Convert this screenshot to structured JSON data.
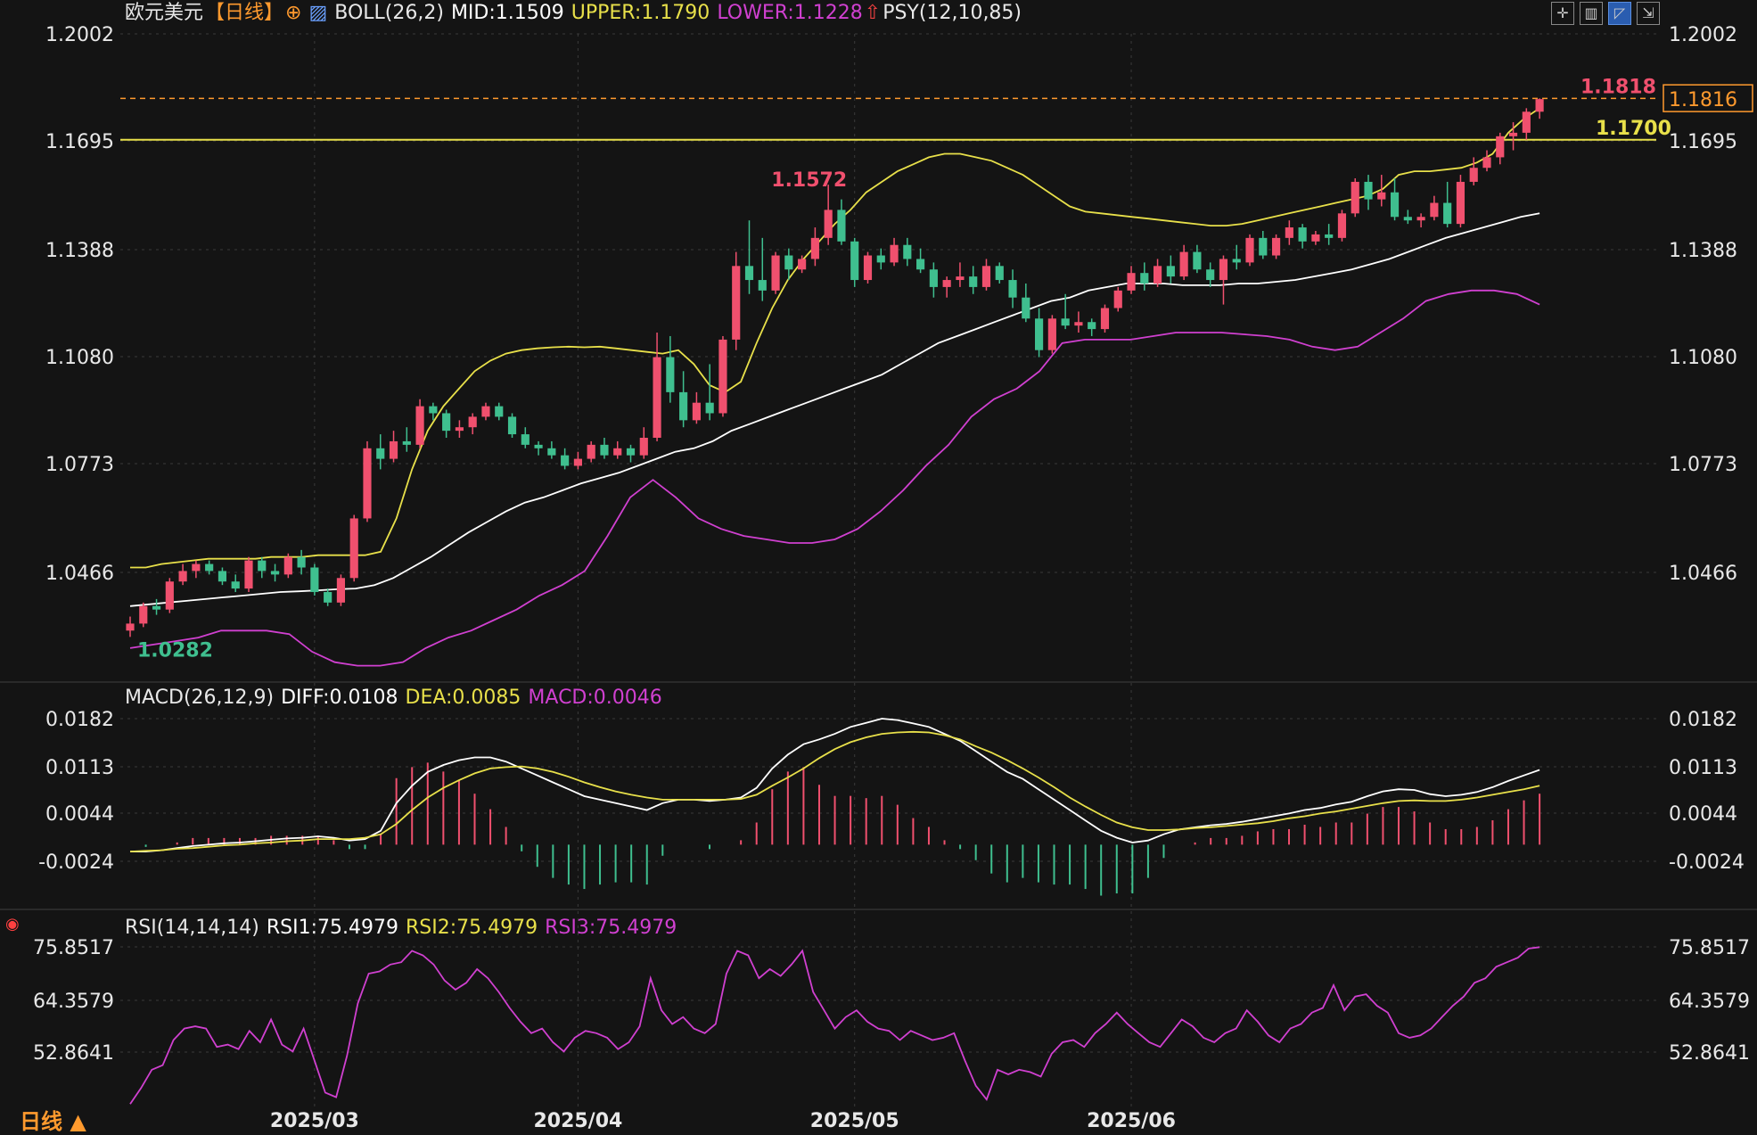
{
  "header": {
    "symbol": "欧元美元",
    "period": "【日线】",
    "boll_label": "BOLL(26,2)",
    "boll_mid": "MID:1.1509",
    "boll_upper": "UPPER:1.1790",
    "boll_lower": "LOWER:1.1228",
    "psy_label": "PSY(12,10,85)"
  },
  "macd_header": {
    "label": "MACD(26,12,9)",
    "diff": "DIFF:0.0108",
    "dea": "DEA:0.0085",
    "macd": "MACD:0.0046"
  },
  "rsi_header": {
    "label": "RSI(14,14,14)",
    "rsi1": "RSI1:75.4979",
    "rsi2": "RSI2:75.4979",
    "rsi3": "RSI3:75.4979"
  },
  "footer": {
    "period_toggle": "日线 ▲"
  },
  "colors": {
    "up": "#f0506e",
    "down": "#3fbf8f",
    "boll_upper": "#e8e04a",
    "boll_mid": "#ffffff",
    "boll_lower": "#d040d0",
    "diff": "#ffffff",
    "dea": "#e8e04a",
    "rsi": "#d040d0",
    "hline": "#e8e04a",
    "last_price": "#ff9a2e"
  },
  "chart_data": [
    {
      "type": "candlestick",
      "name": "price",
      "yticks": [
        "1.2002",
        "1.1695",
        "1.1388",
        "1.1080",
        "1.0773",
        "1.0466"
      ],
      "ylim": [
        1.016,
        1.2002
      ],
      "x_tick_labels": [
        "2025/03",
        "2025/04",
        "2025/05",
        "2025/06"
      ],
      "x_tick_index": [
        14,
        34,
        55,
        76
      ],
      "annotations": {
        "high_label": "1.1572",
        "low_label": "1.0282",
        "max_label": "1.1818",
        "hline_label": "1.1700",
        "last_price_label": "1.1816",
        "hline_value": 1.17,
        "max_value": 1.1818,
        "high_index": 48,
        "low_index": 0
      },
      "candles": [
        [
          1.03,
          1.034,
          1.0282,
          1.032
        ],
        [
          1.032,
          1.038,
          1.031,
          1.037
        ],
        [
          1.037,
          1.039,
          1.0345,
          1.036
        ],
        [
          1.036,
          1.045,
          1.035,
          1.044
        ],
        [
          1.044,
          1.049,
          1.043,
          1.047
        ],
        [
          1.047,
          1.05,
          1.045,
          1.049
        ],
        [
          1.049,
          1.05,
          1.046,
          1.047
        ],
        [
          1.047,
          1.048,
          1.043,
          1.044
        ],
        [
          1.044,
          1.046,
          1.041,
          1.042
        ],
        [
          1.042,
          1.051,
          1.041,
          1.05
        ],
        [
          1.05,
          1.051,
          1.045,
          1.047
        ],
        [
          1.047,
          1.049,
          1.044,
          1.046
        ],
        [
          1.046,
          1.052,
          1.045,
          1.051
        ],
        [
          1.051,
          1.053,
          1.046,
          1.048
        ],
        [
          1.048,
          1.049,
          1.04,
          1.041
        ],
        [
          1.041,
          1.042,
          1.037,
          1.038
        ],
        [
          1.038,
          1.046,
          1.037,
          1.045
        ],
        [
          1.045,
          1.063,
          1.044,
          1.062
        ],
        [
          1.062,
          1.084,
          1.061,
          1.082
        ],
        [
          1.082,
          1.086,
          1.076,
          1.079
        ],
        [
          1.079,
          1.087,
          1.078,
          1.084
        ],
        [
          1.084,
          1.088,
          1.081,
          1.083
        ],
        [
          1.083,
          1.096,
          1.082,
          1.094
        ],
        [
          1.094,
          1.095,
          1.09,
          1.092
        ],
        [
          1.092,
          1.093,
          1.085,
          1.087
        ],
        [
          1.087,
          1.09,
          1.085,
          1.088
        ],
        [
          1.088,
          1.092,
          1.086,
          1.091
        ],
        [
          1.091,
          1.095,
          1.09,
          1.094
        ],
        [
          1.094,
          1.095,
          1.09,
          1.091
        ],
        [
          1.091,
          1.092,
          1.085,
          1.086
        ],
        [
          1.086,
          1.088,
          1.082,
          1.083
        ],
        [
          1.083,
          1.084,
          1.08,
          1.082
        ],
        [
          1.082,
          1.084,
          1.079,
          1.08
        ],
        [
          1.08,
          1.082,
          1.076,
          1.077
        ],
        [
          1.077,
          1.081,
          1.076,
          1.079
        ],
        [
          1.079,
          1.084,
          1.078,
          1.083
        ],
        [
          1.083,
          1.085,
          1.079,
          1.08
        ],
        [
          1.08,
          1.084,
          1.079,
          1.082
        ],
        [
          1.082,
          1.083,
          1.078,
          1.08
        ],
        [
          1.08,
          1.088,
          1.079,
          1.085
        ],
        [
          1.085,
          1.115,
          1.084,
          1.108
        ],
        [
          1.108,
          1.114,
          1.095,
          1.098
        ],
        [
          1.098,
          1.104,
          1.088,
          1.09
        ],
        [
          1.09,
          1.098,
          1.089,
          1.095
        ],
        [
          1.095,
          1.106,
          1.09,
          1.092
        ],
        [
          1.092,
          1.114,
          1.091,
          1.113
        ],
        [
          1.113,
          1.138,
          1.11,
          1.134
        ],
        [
          1.134,
          1.147,
          1.126,
          1.13
        ],
        [
          1.13,
          1.142,
          1.124,
          1.127
        ],
        [
          1.127,
          1.138,
          1.126,
          1.137
        ],
        [
          1.137,
          1.139,
          1.13,
          1.133
        ],
        [
          1.133,
          1.137,
          1.132,
          1.136
        ],
        [
          1.136,
          1.145,
          1.134,
          1.142
        ],
        [
          1.142,
          1.1572,
          1.14,
          1.15
        ],
        [
          1.15,
          1.153,
          1.14,
          1.141
        ],
        [
          1.141,
          1.142,
          1.128,
          1.13
        ],
        [
          1.13,
          1.138,
          1.129,
          1.137
        ],
        [
          1.137,
          1.139,
          1.133,
          1.135
        ],
        [
          1.135,
          1.142,
          1.134,
          1.14
        ],
        [
          1.14,
          1.142,
          1.134,
          1.136
        ],
        [
          1.136,
          1.139,
          1.132,
          1.133
        ],
        [
          1.133,
          1.135,
          1.125,
          1.128
        ],
        [
          1.128,
          1.131,
          1.125,
          1.13
        ],
        [
          1.13,
          1.135,
          1.128,
          1.131
        ],
        [
          1.131,
          1.134,
          1.126,
          1.128
        ],
        [
          1.128,
          1.136,
          1.127,
          1.134
        ],
        [
          1.134,
          1.135,
          1.129,
          1.13
        ],
        [
          1.13,
          1.133,
          1.122,
          1.125
        ],
        [
          1.125,
          1.129,
          1.118,
          1.119
        ],
        [
          1.119,
          1.122,
          1.108,
          1.11
        ],
        [
          1.11,
          1.12,
          1.109,
          1.119
        ],
        [
          1.119,
          1.126,
          1.116,
          1.117
        ],
        [
          1.117,
          1.121,
          1.115,
          1.118
        ],
        [
          1.118,
          1.119,
          1.114,
          1.116
        ],
        [
          1.116,
          1.123,
          1.115,
          1.122
        ],
        [
          1.122,
          1.128,
          1.121,
          1.127
        ],
        [
          1.127,
          1.134,
          1.126,
          1.132
        ],
        [
          1.132,
          1.135,
          1.127,
          1.129
        ],
        [
          1.129,
          1.136,
          1.128,
          1.134
        ],
        [
          1.134,
          1.137,
          1.129,
          1.131
        ],
        [
          1.131,
          1.14,
          1.13,
          1.138
        ],
        [
          1.138,
          1.14,
          1.132,
          1.133
        ],
        [
          1.133,
          1.135,
          1.128,
          1.13
        ],
        [
          1.13,
          1.137,
          1.123,
          1.136
        ],
        [
          1.136,
          1.14,
          1.133,
          1.135
        ],
        [
          1.135,
          1.143,
          1.134,
          1.142
        ],
        [
          1.142,
          1.144,
          1.136,
          1.137
        ],
        [
          1.137,
          1.143,
          1.136,
          1.142
        ],
        [
          1.142,
          1.147,
          1.14,
          1.145
        ],
        [
          1.145,
          1.146,
          1.139,
          1.141
        ],
        [
          1.141,
          1.144,
          1.14,
          1.143
        ],
        [
          1.143,
          1.146,
          1.14,
          1.142
        ],
        [
          1.142,
          1.15,
          1.141,
          1.149
        ],
        [
          1.149,
          1.159,
          1.148,
          1.158
        ],
        [
          1.158,
          1.16,
          1.15,
          1.153
        ],
        [
          1.153,
          1.16,
          1.151,
          1.155
        ],
        [
          1.155,
          1.159,
          1.147,
          1.148
        ],
        [
          1.148,
          1.15,
          1.146,
          1.147
        ],
        [
          1.147,
          1.149,
          1.145,
          1.148
        ],
        [
          1.148,
          1.154,
          1.147,
          1.152
        ],
        [
          1.152,
          1.158,
          1.145,
          1.146
        ],
        [
          1.146,
          1.16,
          1.145,
          1.158
        ],
        [
          1.158,
          1.165,
          1.157,
          1.162
        ],
        [
          1.162,
          1.167,
          1.161,
          1.165
        ],
        [
          1.165,
          1.172,
          1.163,
          1.171
        ],
        [
          1.171,
          1.175,
          1.167,
          1.172
        ],
        [
          1.172,
          1.179,
          1.17,
          1.178
        ],
        [
          1.178,
          1.1818,
          1.176,
          1.1816
        ]
      ],
      "boll_upper": [
        1.048,
        1.048,
        1.049,
        1.0495,
        1.05,
        1.0505,
        1.0505,
        1.0505,
        1.0505,
        1.051,
        1.051,
        1.051,
        1.0515,
        1.0515,
        1.0515,
        1.0515,
        1.0525,
        1.062,
        1.076,
        1.087,
        1.094,
        1.099,
        1.104,
        1.107,
        1.109,
        1.11,
        1.1105,
        1.1108,
        1.111,
        1.1108,
        1.111,
        1.1105,
        1.11,
        1.1095,
        1.109,
        1.11,
        1.106,
        1.1,
        1.098,
        1.101,
        1.112,
        1.122,
        1.13,
        1.136,
        1.141,
        1.146,
        1.15,
        1.155,
        1.158,
        1.161,
        1.163,
        1.165,
        1.166,
        1.166,
        1.165,
        1.164,
        1.162,
        1.16,
        1.157,
        1.154,
        1.151,
        1.1495,
        1.149,
        1.1485,
        1.148,
        1.1475,
        1.147,
        1.1465,
        1.146,
        1.1455,
        1.1455,
        1.146,
        1.147,
        1.148,
        1.149,
        1.15,
        1.151,
        1.152,
        1.153,
        1.154,
        1.156,
        1.16,
        1.161,
        1.161,
        1.1615,
        1.162,
        1.1635,
        1.166,
        1.172,
        1.176,
        1.179
      ],
      "boll_mid": [
        1.037,
        1.0375,
        1.038,
        1.0385,
        1.039,
        1.0395,
        1.04,
        1.0405,
        1.041,
        1.0412,
        1.0415,
        1.0418,
        1.042,
        1.043,
        1.045,
        1.048,
        1.051,
        1.0545,
        1.058,
        1.061,
        1.064,
        1.0665,
        1.068,
        1.07,
        1.072,
        1.0735,
        1.075,
        1.077,
        1.079,
        1.081,
        1.082,
        1.084,
        1.087,
        1.089,
        1.091,
        1.093,
        1.095,
        1.097,
        1.099,
        1.101,
        1.103,
        1.106,
        1.109,
        1.112,
        1.114,
        1.116,
        1.118,
        1.12,
        1.122,
        1.124,
        1.125,
        1.127,
        1.128,
        1.129,
        1.129,
        1.129,
        1.1285,
        1.1285,
        1.1285,
        1.129,
        1.129,
        1.1295,
        1.13,
        1.131,
        1.132,
        1.133,
        1.1345,
        1.136,
        1.138,
        1.14,
        1.142,
        1.1435,
        1.145,
        1.1465,
        1.148,
        1.149
      ],
      "boll_lower": [
        1.025,
        1.026,
        1.027,
        1.028,
        1.03,
        1.03,
        1.03,
        1.029,
        1.024,
        1.021,
        1.02,
        1.02,
        1.021,
        1.025,
        1.028,
        1.03,
        1.033,
        1.036,
        1.04,
        1.043,
        1.047,
        1.057,
        1.068,
        1.073,
        1.068,
        1.062,
        1.059,
        1.057,
        1.056,
        1.055,
        1.055,
        1.056,
        1.059,
        1.064,
        1.07,
        1.077,
        1.083,
        1.091,
        1.096,
        1.099,
        1.104,
        1.112,
        1.113,
        1.113,
        1.113,
        1.114,
        1.115,
        1.115,
        1.115,
        1.1145,
        1.114,
        1.113,
        1.111,
        1.11,
        1.111,
        1.115,
        1.119,
        1.124,
        1.126,
        1.127,
        1.127,
        1.126,
        1.123
      ],
      "macd_yticks": [
        "0.0182",
        "0.0113",
        "0.0044",
        "-0.0024"
      ],
      "macd_ylim": [
        -0.009,
        0.02
      ],
      "diff": [
        -0.001,
        -0.001,
        -0.0008,
        -0.0005,
        -0.0002,
        0.0,
        0.0002,
        0.0003,
        0.0005,
        0.0007,
        0.0009,
        0.001,
        0.0012,
        0.001,
        0.0006,
        0.0008,
        0.002,
        0.006,
        0.0085,
        0.0105,
        0.0115,
        0.0122,
        0.0126,
        0.0126,
        0.012,
        0.011,
        0.01,
        0.009,
        0.008,
        0.007,
        0.0065,
        0.006,
        0.0055,
        0.005,
        0.006,
        0.0065,
        0.0065,
        0.0063,
        0.0065,
        0.0068,
        0.0082,
        0.011,
        0.013,
        0.0145,
        0.0152,
        0.016,
        0.017,
        0.0176,
        0.0182,
        0.018,
        0.0175,
        0.017,
        0.016,
        0.015,
        0.0135,
        0.012,
        0.0105,
        0.0095,
        0.008,
        0.0065,
        0.005,
        0.0035,
        0.002,
        0.001,
        0.0003,
        0.0006,
        0.0015,
        0.0022,
        0.0025,
        0.0028,
        0.003,
        0.0033,
        0.0037,
        0.0041,
        0.0045,
        0.005,
        0.0053,
        0.0058,
        0.0062,
        0.007,
        0.0077,
        0.008,
        0.0079,
        0.0073,
        0.007,
        0.0072,
        0.0076,
        0.0083,
        0.0092,
        0.01,
        0.0108
      ],
      "dea": [
        -0.001,
        -0.0009,
        -0.0008,
        -0.0006,
        -0.0005,
        -0.0003,
        -0.0001,
        0.0,
        0.0002,
        0.0003,
        0.0005,
        0.0006,
        0.0008,
        0.0008,
        0.0008,
        0.001,
        0.0015,
        0.003,
        0.005,
        0.0068,
        0.0082,
        0.0093,
        0.0103,
        0.011,
        0.0112,
        0.0113,
        0.011,
        0.0105,
        0.0098,
        0.009,
        0.0083,
        0.0077,
        0.0072,
        0.0068,
        0.0065,
        0.0065,
        0.0065,
        0.0065,
        0.0065,
        0.0066,
        0.0072,
        0.0085,
        0.0097,
        0.011,
        0.0125,
        0.0138,
        0.0148,
        0.0155,
        0.016,
        0.0162,
        0.0163,
        0.0162,
        0.0158,
        0.0152,
        0.0142,
        0.0133,
        0.0122,
        0.011,
        0.0097,
        0.0083,
        0.0068,
        0.0055,
        0.0043,
        0.0032,
        0.0025,
        0.0021,
        0.0021,
        0.0022,
        0.0024,
        0.0025,
        0.0027,
        0.0029,
        0.0031,
        0.0034,
        0.0038,
        0.0041,
        0.0045,
        0.0048,
        0.0052,
        0.0056,
        0.006,
        0.0063,
        0.0064,
        0.0063,
        0.0063,
        0.0065,
        0.0068,
        0.0072,
        0.0076,
        0.008,
        0.0085
      ],
      "rsi_yticks": [
        "75.8517",
        "64.3579",
        "52.8641"
      ],
      "rsi_ylim": [
        41.0,
        79.0
      ],
      "rsi": [
        41.5,
        45.0,
        49.0,
        50.0,
        55.5,
        58.0,
        58.5,
        58.0,
        54.0,
        54.5,
        53.5,
        57.5,
        55.0,
        60.0,
        54.5,
        53.0,
        58.0,
        51.0,
        44.0,
        43.0,
        52.0,
        63.5,
        70.0,
        70.5,
        72.0,
        72.5,
        75.0,
        74.0,
        72.0,
        68.5,
        66.5,
        68.0,
        71.0,
        69.0,
        66.0,
        62.5,
        59.5,
        57.0,
        58.0,
        55.0,
        53.0,
        56.0,
        57.5,
        57.0,
        56.0,
        53.5,
        55.0,
        58.5,
        69.0,
        62.0,
        59.0,
        60.5,
        58.0,
        57.0,
        59.0,
        70.0,
        75.0,
        74.0,
        69.0,
        71.0,
        69.5,
        72.0,
        75.0,
        66.0,
        62.0,
        58.0,
        60.5,
        62.0,
        59.5,
        58.0,
        57.5,
        55.5,
        57.5,
        56.5,
        55.5,
        56.0,
        57.0,
        51.0,
        45.5,
        42.5,
        49.0,
        48.0,
        49.0,
        48.5,
        47.5,
        52.5,
        55.0,
        55.5,
        54.0,
        57.0,
        59.0,
        61.5,
        59.0,
        57.0,
        55.0,
        54.0,
        57.0,
        60.0,
        58.5,
        56.0,
        55.0,
        57.0,
        58.0,
        62.0,
        59.5,
        56.5,
        55.0,
        58.0,
        59.0,
        61.5,
        62.5,
        67.5,
        62.0,
        65.0,
        65.5,
        63.0,
        61.5,
        57.0,
        56.0,
        56.5,
        58.0,
        60.5,
        63.0,
        65.0,
        68.0,
        69.0,
        71.5,
        72.5,
        73.5,
        75.5,
        75.8
      ]
    }
  ]
}
